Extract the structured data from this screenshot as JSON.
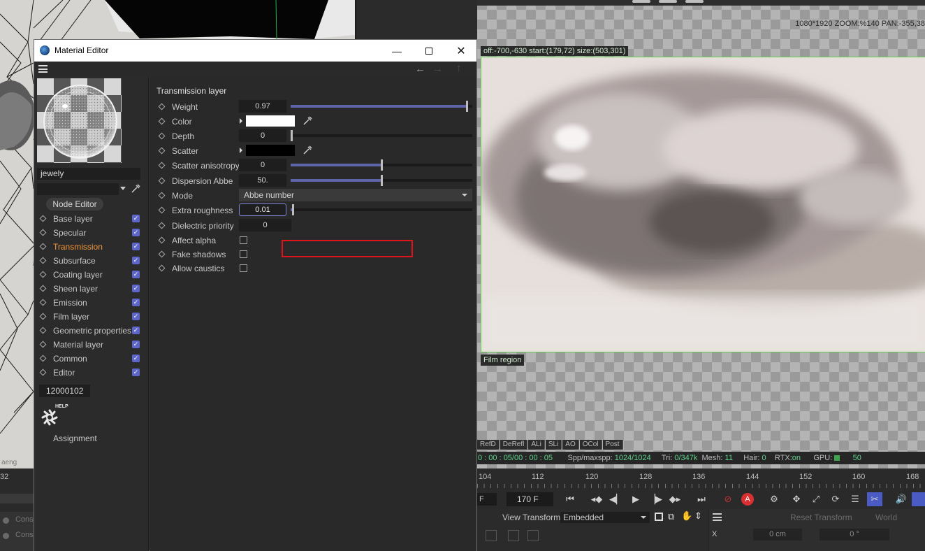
{
  "background": {
    "viewport_label_fragment": "aeng"
  },
  "render_viewer": {
    "top_info": "1080*1920 ZOOM:%140   PAN:-355,38",
    "region_label": "off:-700,-630 start:(179,72) size:(503,301)",
    "film_region_label": "Film region",
    "tabs": [
      "RefD",
      "DeRefl",
      "ALi",
      "SLi",
      "AO",
      "OCol",
      "Post"
    ],
    "status": {
      "time": "0 : 00 : 05/00 : 00 : 05",
      "spp_label": "Spp/maxspp:",
      "spp_value": "1024/1024",
      "tri_label": "Tri:",
      "tri_value": "0/347k",
      "mesh_label": "Mesh:",
      "mesh_value": "11",
      "hair_label": "Hair:",
      "hair_value": "0",
      "rtx_label": "RTX:",
      "rtx_value": "on",
      "gpu_label": "GPU:",
      "gpu_value": "50"
    }
  },
  "timeline": {
    "left_ruler_labels": [
      "32"
    ],
    "ruler_labels": [
      "104",
      "112",
      "120",
      "128",
      "136",
      "144",
      "152",
      "160",
      "168"
    ],
    "frame_small": "F",
    "current_frame": "170 F",
    "view_transform_label": "View Transform",
    "view_transform_value": "Embedded",
    "reset_transform": "Reset Transform",
    "world": "World",
    "coord_axis": "X",
    "coord_cm": "0 cm",
    "coord_deg": "0 °",
    "left_rows": [
      "Cons",
      "Cons"
    ]
  },
  "material_editor": {
    "window_title": "Material Editor",
    "material_name": "jewely",
    "node_editor_button": "Node Editor",
    "channels": [
      {
        "label": "Base layer",
        "checked": true
      },
      {
        "label": "Specular",
        "checked": true
      },
      {
        "label": "Transmission",
        "checked": true,
        "active": true
      },
      {
        "label": "Subsurface",
        "checked": true
      },
      {
        "label": "Coating layer",
        "checked": true
      },
      {
        "label": "Sheen layer",
        "checked": true
      },
      {
        "label": "Emission",
        "checked": true
      },
      {
        "label": "Film layer",
        "checked": true
      },
      {
        "label": "Geometric properties",
        "checked": true
      },
      {
        "label": "Material layer",
        "checked": true
      },
      {
        "label": "Common",
        "checked": true
      },
      {
        "label": "Editor",
        "checked": true
      }
    ],
    "material_id": "12000102",
    "help_label": "HELP",
    "assignment_label": "Assignment",
    "section_title": "Transmission layer",
    "params": {
      "weight": {
        "label": "Weight",
        "value": "0.97",
        "fraction": 0.97
      },
      "color": {
        "label": "Color",
        "swatch": "#ffffff"
      },
      "depth": {
        "label": "Depth",
        "value": "0",
        "fraction": 0.0
      },
      "scatter": {
        "label": "Scatter",
        "swatch": "#000000"
      },
      "scatter_aniso": {
        "label": "Scatter anisotropy",
        "value": "0",
        "fraction": 0.5
      },
      "dispersion": {
        "label": "Dispersion Abbe",
        "value": "50.",
        "fraction": 0.5
      },
      "mode": {
        "label": "Mode",
        "value": "Abbe number"
      },
      "extra_roughness": {
        "label": "Extra roughness",
        "value": "0.01",
        "fraction": 0.01
      },
      "dielectric": {
        "label": "Dielectric priority",
        "value": "0"
      },
      "affect_alpha": {
        "label": "Affect alpha",
        "checked": false
      },
      "fake_shadows": {
        "label": "Fake shadows",
        "checked": false
      },
      "allow_caustics": {
        "label": "Allow caustics",
        "checked": false
      }
    }
  },
  "colors": {
    "accent_orange": "#f0953a",
    "checkbox_blue": "#5e67c9",
    "slider_fill": "#5f64a8",
    "highlight_red": "#e0121b",
    "region_green": "#62d24a",
    "status_green": "#5ed38c"
  }
}
